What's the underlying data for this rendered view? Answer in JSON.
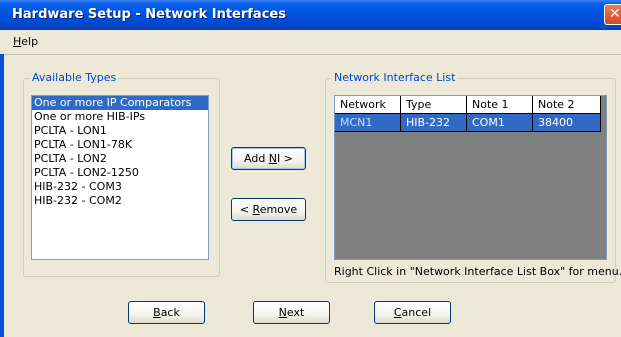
{
  "window": {
    "title": "Hardware Setup - Network Interfaces",
    "close_glyph": "✕",
    "accent_color": "#0054e3",
    "selection_color": "#316ac5"
  },
  "menu": {
    "help": {
      "mnemonic": "H",
      "rest": "elp"
    }
  },
  "available_types": {
    "legend": "Available Types",
    "items": [
      {
        "label": "One or more IP Comparators",
        "selected": true
      },
      {
        "label": "One or more HIB-IPs",
        "selected": false
      },
      {
        "label": "PCLTA - LON1",
        "selected": false
      },
      {
        "label": "PCLTA - LON1-78K",
        "selected": false
      },
      {
        "label": "PCLTA - LON2",
        "selected": false
      },
      {
        "label": "PCLTA - LON2-1250",
        "selected": false
      },
      {
        "label": "HIB-232 - COM3",
        "selected": false
      },
      {
        "label": "HIB-232 - COM2",
        "selected": false
      }
    ]
  },
  "actions": {
    "add": {
      "before": "Add ",
      "mnemonic": "N",
      "after": "I >"
    },
    "remove": {
      "before": "< ",
      "mnemonic": "R",
      "after": "emove"
    }
  },
  "network_interface_list": {
    "legend": "Network Interface List",
    "columns": [
      "Network",
      "Type",
      "Note 1",
      "Note 2"
    ],
    "rows": [
      {
        "network": "MCN1",
        "type": "HIB-232",
        "note1": "COM1",
        "note2": "38400"
      }
    ],
    "hint": "Right Click in \"Network Interface List Box\" for menu."
  },
  "footer": {
    "back": {
      "mnemonic": "B",
      "rest": "ack"
    },
    "next": {
      "mnemonic": "N",
      "rest": "ext"
    },
    "cancel": {
      "mnemonic": "C",
      "rest": "ancel"
    }
  }
}
